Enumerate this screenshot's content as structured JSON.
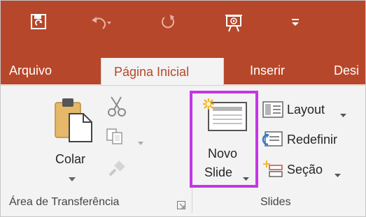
{
  "qat": {
    "save_icon": "save-sync-icon",
    "undo_icon": "undo-icon",
    "redo_icon": "redo-icon",
    "present_icon": "present-from-beginning-icon",
    "customize_icon": "customize-qat-icon"
  },
  "tabs": [
    {
      "label": "Arquivo",
      "active": false
    },
    {
      "label": "Página Inicial",
      "active": true
    },
    {
      "label": "Inserir",
      "active": false
    },
    {
      "label": "Desi",
      "active": false
    }
  ],
  "clipboard_group": {
    "paste_label": "Colar",
    "cut_icon": "scissors-icon",
    "copy_icon": "copy-icon",
    "format_painter_icon": "format-painter-icon",
    "group_label": "Área de Transferência",
    "launcher_icon": "dialog-launcher-icon"
  },
  "slides_group": {
    "new_slide_line1": "Novo",
    "new_slide_line2": "Slide",
    "layout_label": "Layout",
    "reset_label": "Redefinir",
    "section_label": "Seção",
    "group_label": "Slides"
  },
  "colors": {
    "brand": "#b7472a",
    "ribbon_bg": "#f3f3f3",
    "highlight": "#c536e6"
  }
}
